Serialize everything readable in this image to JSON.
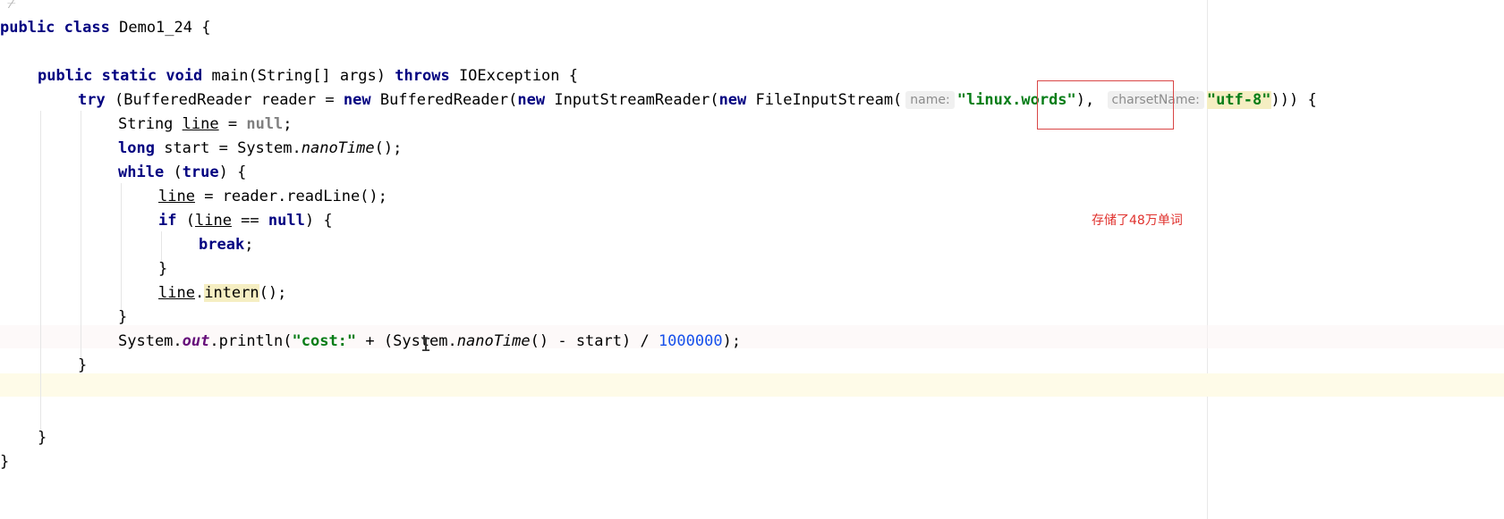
{
  "code": {
    "l1": {
      "kw1": "public",
      "kw2": "class",
      "name": "Demo1_24",
      "brace": "{"
    },
    "l3": {
      "kw1": "public",
      "kw2": "static",
      "kw3": "void",
      "sig": "main(String[] args)",
      "kw4": "throws",
      "exc": "IOException",
      "brace": "{"
    },
    "l4": {
      "kw_try": "try",
      "p1": "(BufferedReader reader =",
      "kw_new1": "new",
      "p2": "BufferedReader(",
      "kw_new2": "new",
      "p3": "InputStreamReader(",
      "kw_new3": "new",
      "p4": "FileInputStream(",
      "hint_name": "name:",
      "file_str": "\"linux.words\"",
      "p5": "),",
      "hint_charset": "charsetName:",
      "charset_str": "\"utf-8\"",
      "p6": "))) {"
    },
    "l5": {
      "type": "String",
      "var": "line",
      "eq": " = ",
      "nullv": "null",
      "semi": ";"
    },
    "l6": {
      "kw": "long",
      "p1": "start = System.",
      "method": "nanoTime",
      "p2": "();"
    },
    "l7": {
      "kw": "while",
      "p1": "(",
      "kw2": "true",
      "p2": ") {"
    },
    "l8": {
      "var": "line",
      "p1": " = reader.readLine();"
    },
    "l9": {
      "kw": "if",
      "p1": "(",
      "var": "line",
      "p2": " == ",
      "kw2": "null",
      "p3": ") {"
    },
    "l10": {
      "kw": "break",
      "p1": ";"
    },
    "l11": {
      "p1": "}"
    },
    "l12": {
      "var": "line",
      "dot": ".",
      "method": "intern",
      "p1": "();"
    },
    "l13": {
      "p1": "}"
    },
    "l14": {
      "p1": "System.",
      "field": "out",
      "p2": ".println(",
      "str": "\"cost:\"",
      "p3": " + (System.",
      "method": "nanoTime",
      "p4": "() - start) / ",
      "num": "1000000",
      "p5": ");"
    },
    "l15": {
      "p1": "}"
    },
    "l18": {
      "p1": "}"
    },
    "l19": {
      "p1": "}"
    }
  },
  "annotation": {
    "note": "存储了48万单词",
    "color": "#e0322e"
  },
  "colors": {
    "keyword": "#000080",
    "string": "#067d17",
    "number": "#1750eb",
    "background": "#ffffff",
    "current_line": "#fefbe8"
  }
}
